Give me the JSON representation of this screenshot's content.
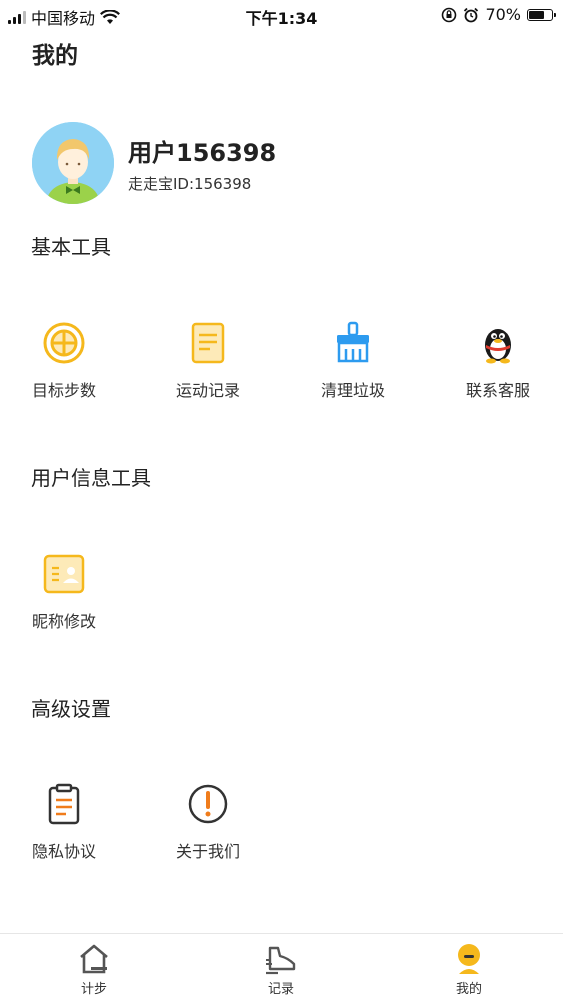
{
  "status_bar": {
    "carrier": "中国移动",
    "time": "下午1:34",
    "battery": "70%",
    "battery_level": 0.7
  },
  "page": {
    "title": "我的"
  },
  "profile": {
    "username": "用户156398",
    "user_id": "走走宝ID:156398"
  },
  "sections": {
    "basic": {
      "title": "基本工具",
      "items": [
        {
          "label": "目标步数",
          "icon": "target-icon"
        },
        {
          "label": "运动记录",
          "icon": "record-icon"
        },
        {
          "label": "清理垃圾",
          "icon": "broom-icon"
        },
        {
          "label": "联系客服",
          "icon": "qq-penguin-icon"
        }
      ]
    },
    "user_info": {
      "title": "用户信息工具",
      "items": [
        {
          "label": "昵称修改",
          "icon": "id-card-icon"
        }
      ]
    },
    "advanced": {
      "title": "高级设置",
      "items": [
        {
          "label": "隐私协议",
          "icon": "clipboard-icon"
        },
        {
          "label": "关于我们",
          "icon": "exclamation-icon"
        }
      ]
    }
  },
  "bottom_nav": {
    "items": [
      {
        "label": "计步",
        "icon": "home-icon"
      },
      {
        "label": "记录",
        "icon": "shoe-icon"
      },
      {
        "label": "我的",
        "icon": "person-icon",
        "active": true
      }
    ]
  },
  "colors": {
    "accent_yellow": "#f5b81c",
    "accent_blue": "#2d9bef",
    "dark_icon": "#333333",
    "orange": "#f07c1b"
  }
}
